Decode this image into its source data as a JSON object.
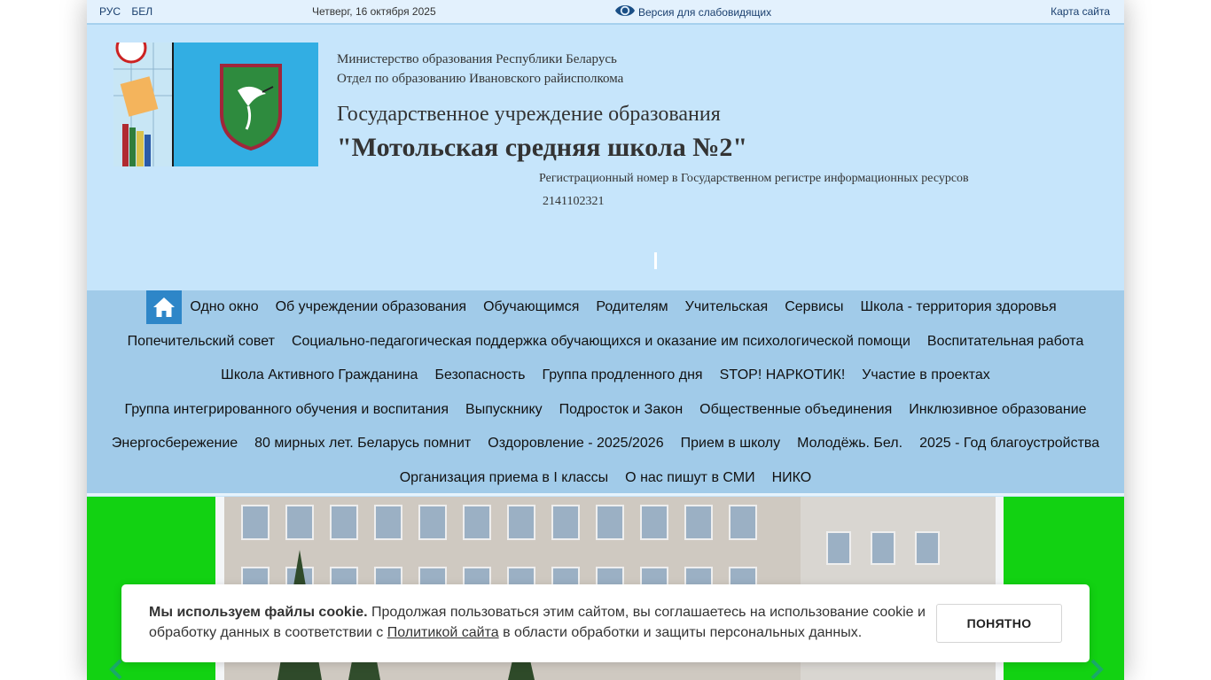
{
  "topbar": {
    "lang_ru": "РУС",
    "lang_be": "БЕЛ",
    "date": "Четверг, 16 октября 2025",
    "vision_label": "Версия для слабовидящих",
    "sitemap": "Карта сайта"
  },
  "header": {
    "ministry": "Министерство образования Республики Беларусь",
    "department": "Отдел по образованию Ивановского райисполкома",
    "institution": "Государственное учреждение образования",
    "school": "\"Мотольская средняя школа №2\"",
    "reg_label": "Регистрационный номер в Государственном регистре информационных ресурсов",
    "reg_number": "2141102321"
  },
  "nav": {
    "rows": [
      [
        "Одно окно",
        "Об учреждении образования",
        "Обучающимся",
        "Родителям",
        "Учительская",
        "Сервисы",
        "Школа - территория здоровья"
      ],
      [
        "Попечительский совет",
        "Социально-педагогическая поддержка обучающихся и оказание им психологической помощи",
        "Воспитательная работа"
      ],
      [
        "Школа Активного Гражданина",
        "Безопасность",
        "Группа продленного дня",
        "STOP! НАРКОТИК!",
        "Участие в проектах"
      ],
      [
        "Группа интегрированного обучения и воспитания",
        "Выпускнику",
        "Подросток и Закон",
        "Общественные объединения",
        "Инклюзивное образование"
      ],
      [
        "Энергосбережение",
        "80 мирных лет. Беларусь помнит",
        "Оздоровление - 2025/2026",
        "Прием в школу",
        "Молодёжь. Бел.",
        "2025 - Год благоустройства"
      ],
      [
        "Организация приема в I классы",
        "О нас пишут в СМИ",
        "НИКО"
      ]
    ]
  },
  "cookie": {
    "bold": "Мы используем файлы cookie.",
    "text1": " Продолжая пользоваться этим сайтом, вы соглашаетесь на использование cookie и обработку данных в соответствии с ",
    "link": "Политикой сайта",
    "text2": " в области обработки и защиты персональных данных.",
    "button": "ПОНЯТНО"
  },
  "colors": {
    "header_bg": "#c6e5fb",
    "nav_bg": "#a1cbe9",
    "home_btn": "#2e86c8",
    "slider_bg": "#12d212"
  },
  "icons": {
    "vision": "eye-icon",
    "home": "home-icon",
    "prev": "chevron-left-icon",
    "next": "chevron-right-icon"
  }
}
